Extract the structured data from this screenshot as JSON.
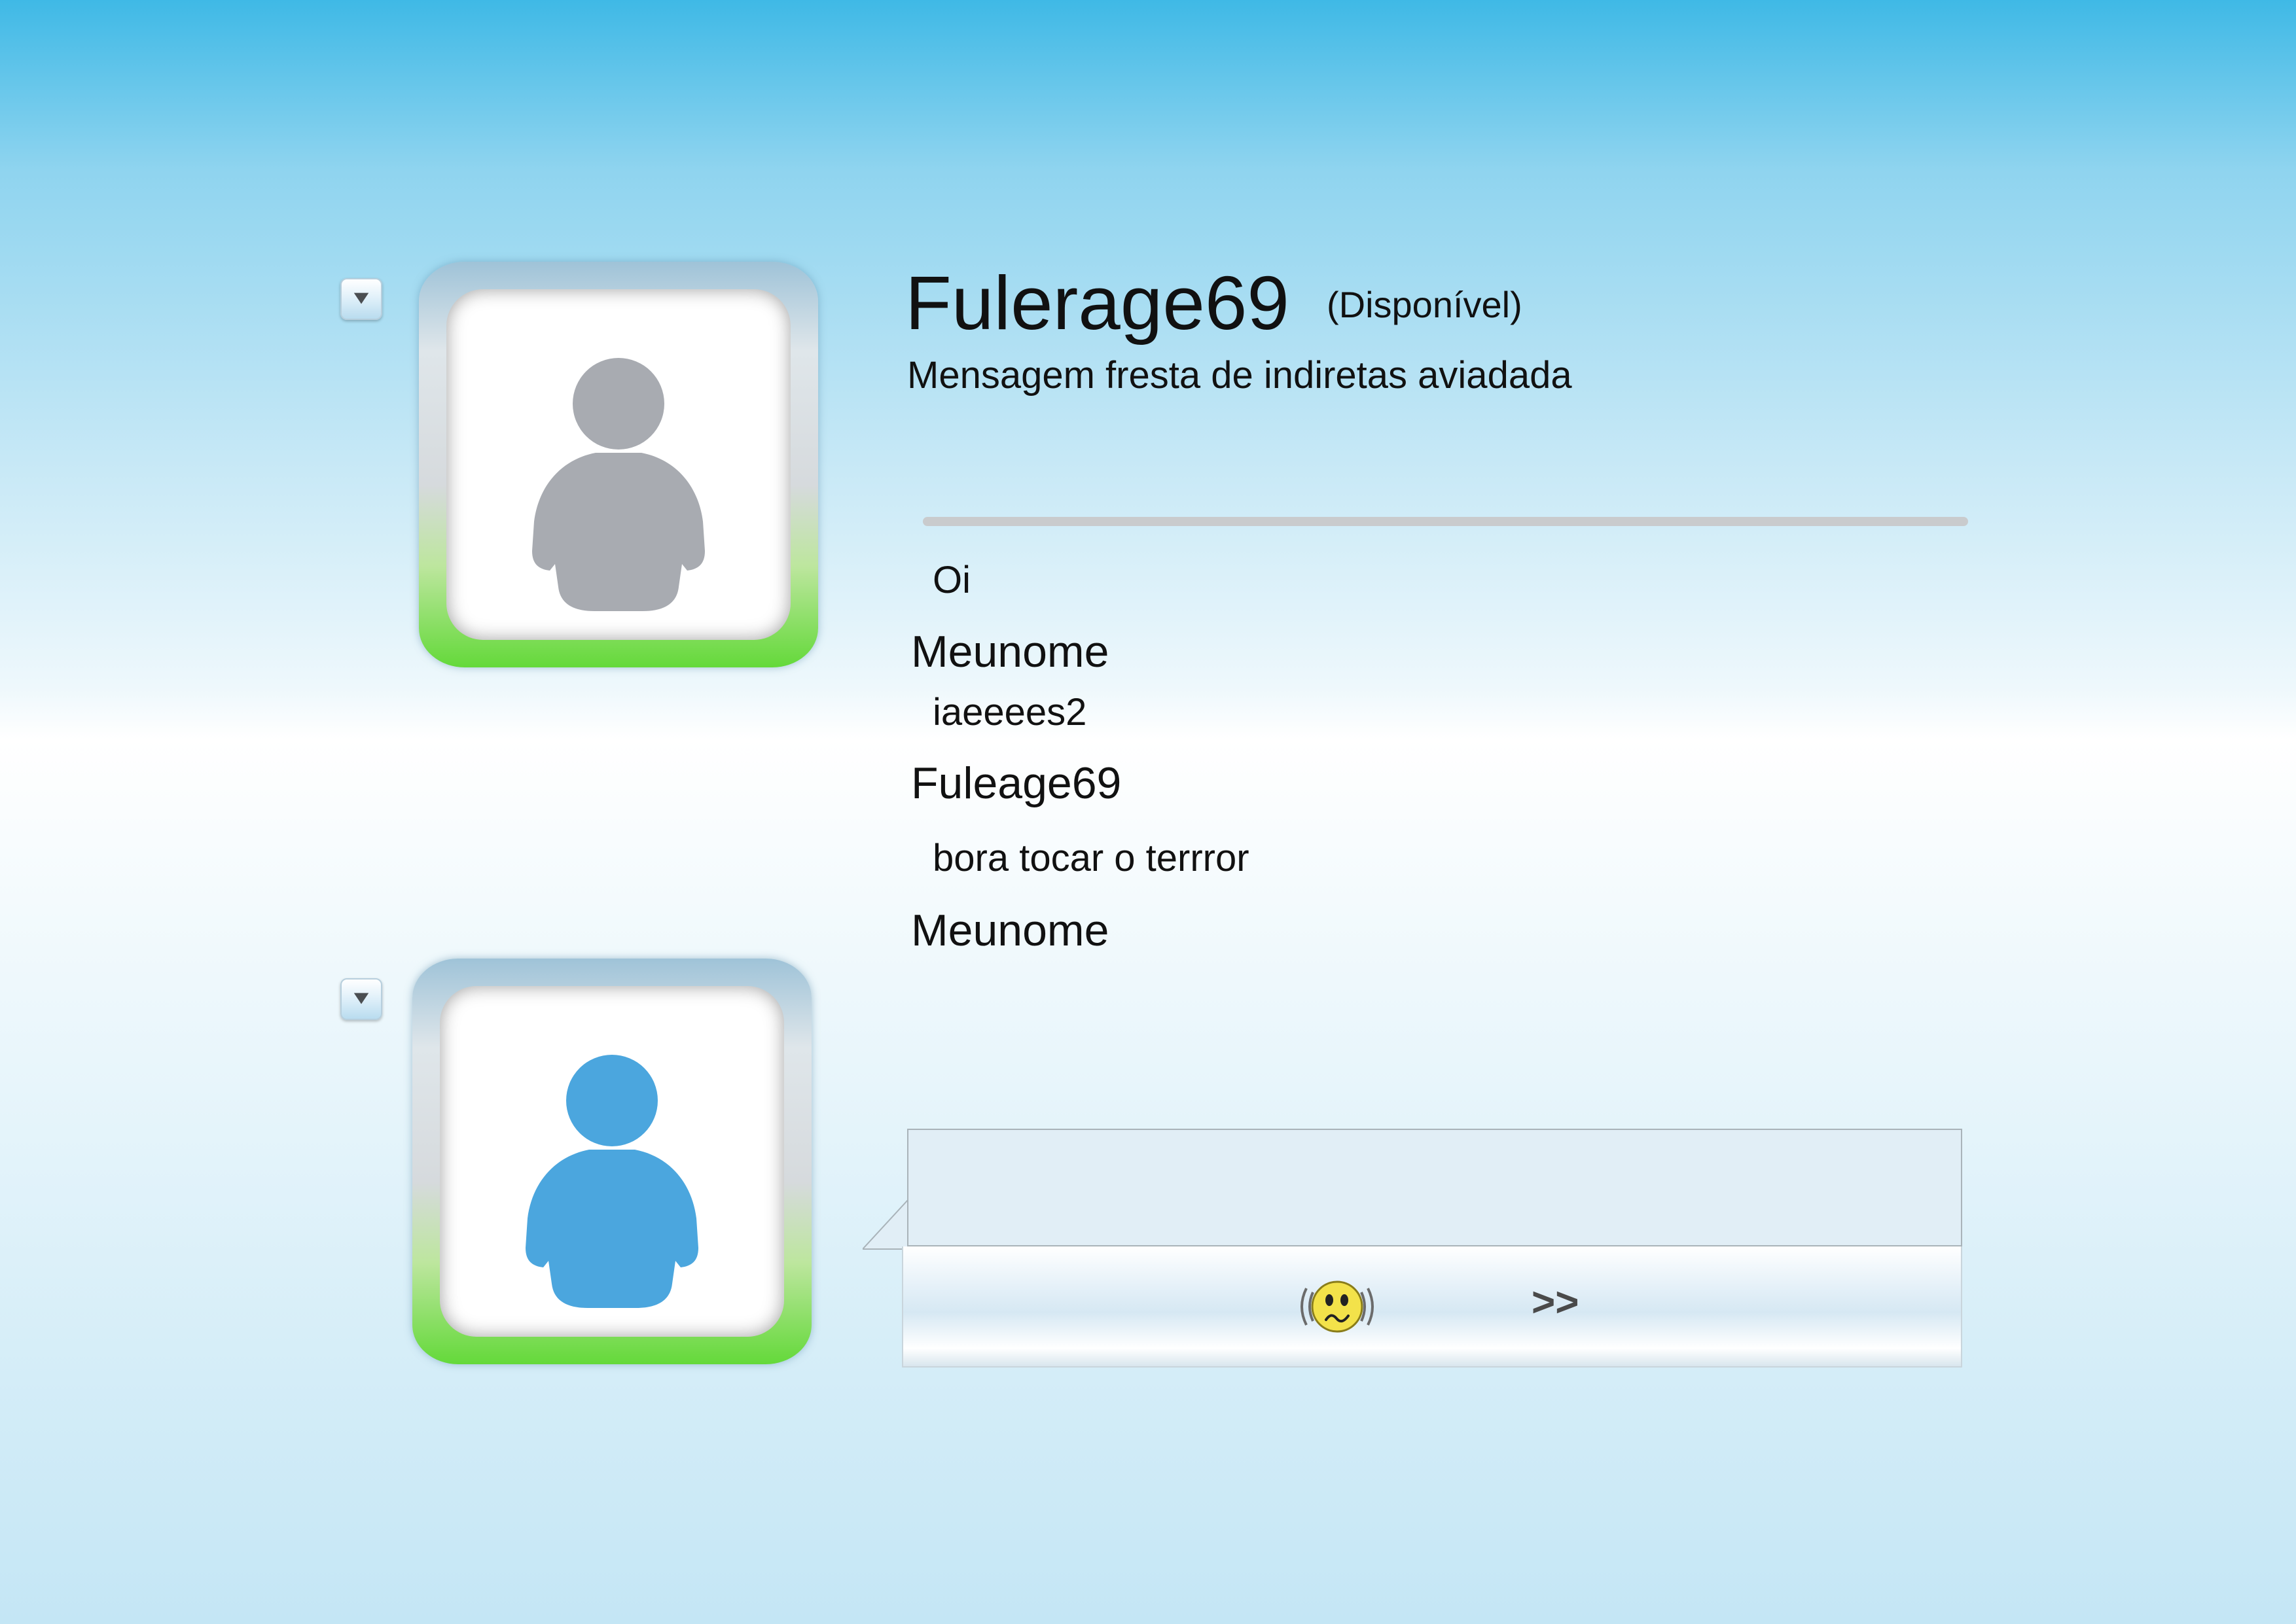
{
  "contact": {
    "display_name": "Fulerage69",
    "status": "(Disponível)",
    "personal_message": "Mensagem fresta de indiretas aviadada",
    "avatar_color": "#a8abb1"
  },
  "self": {
    "avatar_color": "#4ba6de"
  },
  "conversation": {
    "entries": [
      {
        "text": "Oi",
        "sender": "Meunome"
      },
      {
        "text": "iaeeees2",
        "sender": "Fuleage69"
      },
      {
        "text": "bora tocar o terrror",
        "sender": "Meunome"
      }
    ]
  },
  "composer": {
    "nudge_icon": "nudge-emoticon-icon",
    "more_label": ">>"
  },
  "colors": {
    "frame_green": "#64d93a",
    "divider": "#c9cbcd",
    "input_background": "#e1eef6"
  }
}
